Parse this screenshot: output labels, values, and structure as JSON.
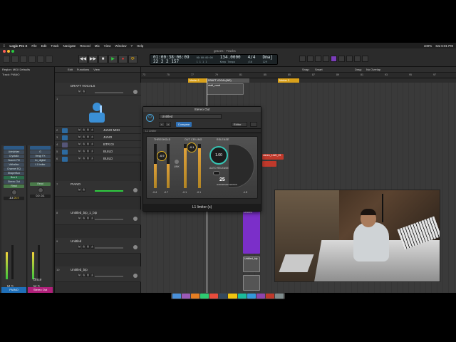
{
  "menubar": {
    "app": "Logic Pro X",
    "items": [
      "File",
      "Edit",
      "Track",
      "Navigate",
      "Record",
      "Mix",
      "View",
      "Window",
      "?",
      "Help"
    ],
    "clock": "Sat 6:01 PM",
    "battery": "100%"
  },
  "window": {
    "title": "graces - Tracks"
  },
  "lcd": {
    "time": "01:00:38:06:09",
    "time2": "00:00:00:00",
    "bars": "22  2  2  157",
    "bars2": "1  1  1  1",
    "tempo": "134.0000",
    "tempo_label": "Keep Tempo",
    "sig": "4/4",
    "div": "/16",
    "key": "Dmaj",
    "count": "129"
  },
  "inspector": {
    "region": "Region: MIDI Defaults",
    "track": "Track: PIANO",
    "plugins_left": [
      "Crystallz",
      "Scaner Fill",
      "Valhallan",
      "Channel EQ",
      "ShaperBox"
    ],
    "plugins_right": [
      "Vengi FX",
      "bx_digital",
      "L1 limiter"
    ],
    "setting_left": "Adelphiae",
    "setting_right": "G",
    "bus": "Bus 6",
    "out_left": "Stereo Out",
    "read": "Read",
    "val_left": "-6.4",
    "val_left2": "26.9",
    "val_right": "0.0",
    "val_right2": "-0.1",
    "btn_ms": "M  S",
    "bnce": "Bnce",
    "name_left": "PIANO",
    "name_right": "Stereo Out"
  },
  "arrange_bar": {
    "edit": "Edit",
    "functions": "Functions",
    "view": "View",
    "snap_label": "Snap:",
    "snap": "Smart",
    "drag_label": "Drag:",
    "drag": "No Overlap"
  },
  "ruler": [
    "73",
    "75",
    "77",
    "79",
    "81",
    "85",
    "85",
    "87",
    "89",
    "81",
    "93",
    "95",
    "97"
  ],
  "markers": [
    {
      "label": "Marker 1",
      "color": "#d9a11b"
    },
    {
      "label": "DRAFT VOCAL(INS)",
      "color": "#555555"
    },
    {
      "label": "Marker 3",
      "color": "#d9a11b"
    }
  ],
  "tracks": [
    {
      "num": "",
      "name": "DRAFT VOCALS"
    },
    {
      "num": "1",
      "name": ""
    },
    {
      "num": "2",
      "name": "JUNO MIDI"
    },
    {
      "num": "3",
      "name": "JUNO"
    },
    {
      "num": "4",
      "name": "BTR DI"
    },
    {
      "num": "5",
      "name": "BUILD"
    },
    {
      "num": "6",
      "name": "BUILD"
    },
    {
      "num": "7",
      "name": "PIANO"
    },
    {
      "num": "8",
      "name": "Untitled_bip_1_bip"
    },
    {
      "num": "9",
      "name": "Untitled"
    },
    {
      "num": "10",
      "name": "Untitled_bip"
    }
  ],
  "regions": {
    "vocals": "DRAFT VOCALS",
    "draft": "draft_vocal",
    "stems": "stereo_14#0_25",
    "untitled": "Untitled",
    "untitled_bip": "Untitled_bip"
  },
  "plugin": {
    "window_title": "Stereo Out",
    "preset": "Untitled",
    "compare": "Compare",
    "editor": "Editor",
    "sub": "L1 Limiter",
    "threshold_label": "THRESHOLD",
    "ceiling_label": "OUT CEILING",
    "release_label": "RELEASE",
    "threshold_val": "-6.9",
    "ceiling_val": "-0.1",
    "release_val": "1.00",
    "auto_release": "AUTO RELEASE",
    "link": "LINK",
    "meter_l": "-0.4",
    "meter_r": "-0.7",
    "ceil_l": "-0.1",
    "ceil_r": "-0.1",
    "atten": "-1.5",
    "logo": "25",
    "logo_sub": "ANNIVERSARY EDITION",
    "footer": "L1 limiter (s)",
    "threshold_level": 0.55,
    "ceiling_level": 0.9
  },
  "colors": {
    "accent": "#2f6fb3",
    "teal": "#35c4b3",
    "gold": "#e0b01e",
    "green": "#2ecc40",
    "region_purple": "#7b2fc9",
    "region_red": "#c0392b"
  }
}
